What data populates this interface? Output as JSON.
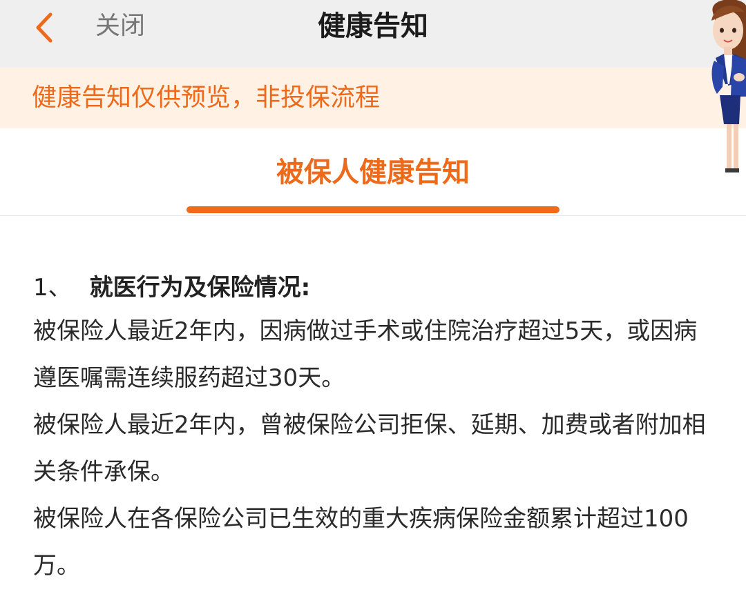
{
  "header": {
    "back_icon": "chevron-left-icon",
    "close_label": "关闭",
    "title": "健康告知",
    "accent_color": "#ee6a1b"
  },
  "notice": {
    "text": "健康告知仅供预览，非投保流程"
  },
  "tabs": [
    {
      "label": "被保人健康告知",
      "active": true
    }
  ],
  "section": {
    "number": "1、",
    "title": "就医行为及保险情况:",
    "items": [
      "被保险人最近2年内，因病做过手术或住院治疗超过5天，或因病遵医嘱需连续服药超过30天。",
      "被保险人最近2年内，曾被保险公司拒保、延期、加费或者附加相关条件承保。",
      "被保险人在各保险公司已生效的重大疾病保险金额累计超过100万。"
    ]
  }
}
